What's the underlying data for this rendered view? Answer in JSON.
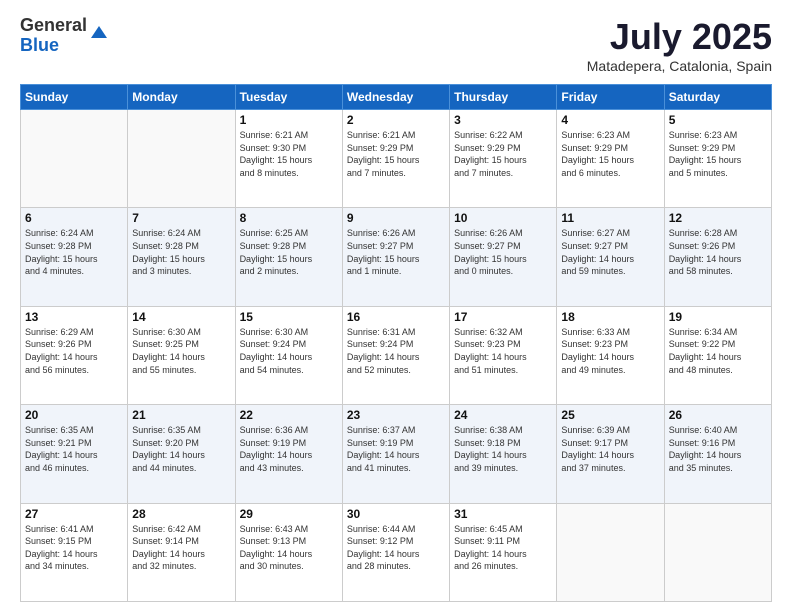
{
  "header": {
    "logo_general": "General",
    "logo_blue": "Blue",
    "month": "July 2025",
    "location": "Matadepera, Catalonia, Spain"
  },
  "days_of_week": [
    "Sunday",
    "Monday",
    "Tuesday",
    "Wednesday",
    "Thursday",
    "Friday",
    "Saturday"
  ],
  "weeks": [
    [
      {
        "day": "",
        "text": ""
      },
      {
        "day": "",
        "text": ""
      },
      {
        "day": "1",
        "text": "Sunrise: 6:21 AM\nSunset: 9:30 PM\nDaylight: 15 hours\nand 8 minutes."
      },
      {
        "day": "2",
        "text": "Sunrise: 6:21 AM\nSunset: 9:29 PM\nDaylight: 15 hours\nand 7 minutes."
      },
      {
        "day": "3",
        "text": "Sunrise: 6:22 AM\nSunset: 9:29 PM\nDaylight: 15 hours\nand 7 minutes."
      },
      {
        "day": "4",
        "text": "Sunrise: 6:23 AM\nSunset: 9:29 PM\nDaylight: 15 hours\nand 6 minutes."
      },
      {
        "day": "5",
        "text": "Sunrise: 6:23 AM\nSunset: 9:29 PM\nDaylight: 15 hours\nand 5 minutes."
      }
    ],
    [
      {
        "day": "6",
        "text": "Sunrise: 6:24 AM\nSunset: 9:28 PM\nDaylight: 15 hours\nand 4 minutes."
      },
      {
        "day": "7",
        "text": "Sunrise: 6:24 AM\nSunset: 9:28 PM\nDaylight: 15 hours\nand 3 minutes."
      },
      {
        "day": "8",
        "text": "Sunrise: 6:25 AM\nSunset: 9:28 PM\nDaylight: 15 hours\nand 2 minutes."
      },
      {
        "day": "9",
        "text": "Sunrise: 6:26 AM\nSunset: 9:27 PM\nDaylight: 15 hours\nand 1 minute."
      },
      {
        "day": "10",
        "text": "Sunrise: 6:26 AM\nSunset: 9:27 PM\nDaylight: 15 hours\nand 0 minutes."
      },
      {
        "day": "11",
        "text": "Sunrise: 6:27 AM\nSunset: 9:27 PM\nDaylight: 14 hours\nand 59 minutes."
      },
      {
        "day": "12",
        "text": "Sunrise: 6:28 AM\nSunset: 9:26 PM\nDaylight: 14 hours\nand 58 minutes."
      }
    ],
    [
      {
        "day": "13",
        "text": "Sunrise: 6:29 AM\nSunset: 9:26 PM\nDaylight: 14 hours\nand 56 minutes."
      },
      {
        "day": "14",
        "text": "Sunrise: 6:30 AM\nSunset: 9:25 PM\nDaylight: 14 hours\nand 55 minutes."
      },
      {
        "day": "15",
        "text": "Sunrise: 6:30 AM\nSunset: 9:24 PM\nDaylight: 14 hours\nand 54 minutes."
      },
      {
        "day": "16",
        "text": "Sunrise: 6:31 AM\nSunset: 9:24 PM\nDaylight: 14 hours\nand 52 minutes."
      },
      {
        "day": "17",
        "text": "Sunrise: 6:32 AM\nSunset: 9:23 PM\nDaylight: 14 hours\nand 51 minutes."
      },
      {
        "day": "18",
        "text": "Sunrise: 6:33 AM\nSunset: 9:23 PM\nDaylight: 14 hours\nand 49 minutes."
      },
      {
        "day": "19",
        "text": "Sunrise: 6:34 AM\nSunset: 9:22 PM\nDaylight: 14 hours\nand 48 minutes."
      }
    ],
    [
      {
        "day": "20",
        "text": "Sunrise: 6:35 AM\nSunset: 9:21 PM\nDaylight: 14 hours\nand 46 minutes."
      },
      {
        "day": "21",
        "text": "Sunrise: 6:35 AM\nSunset: 9:20 PM\nDaylight: 14 hours\nand 44 minutes."
      },
      {
        "day": "22",
        "text": "Sunrise: 6:36 AM\nSunset: 9:19 PM\nDaylight: 14 hours\nand 43 minutes."
      },
      {
        "day": "23",
        "text": "Sunrise: 6:37 AM\nSunset: 9:19 PM\nDaylight: 14 hours\nand 41 minutes."
      },
      {
        "day": "24",
        "text": "Sunrise: 6:38 AM\nSunset: 9:18 PM\nDaylight: 14 hours\nand 39 minutes."
      },
      {
        "day": "25",
        "text": "Sunrise: 6:39 AM\nSunset: 9:17 PM\nDaylight: 14 hours\nand 37 minutes."
      },
      {
        "day": "26",
        "text": "Sunrise: 6:40 AM\nSunset: 9:16 PM\nDaylight: 14 hours\nand 35 minutes."
      }
    ],
    [
      {
        "day": "27",
        "text": "Sunrise: 6:41 AM\nSunset: 9:15 PM\nDaylight: 14 hours\nand 34 minutes."
      },
      {
        "day": "28",
        "text": "Sunrise: 6:42 AM\nSunset: 9:14 PM\nDaylight: 14 hours\nand 32 minutes."
      },
      {
        "day": "29",
        "text": "Sunrise: 6:43 AM\nSunset: 9:13 PM\nDaylight: 14 hours\nand 30 minutes."
      },
      {
        "day": "30",
        "text": "Sunrise: 6:44 AM\nSunset: 9:12 PM\nDaylight: 14 hours\nand 28 minutes."
      },
      {
        "day": "31",
        "text": "Sunrise: 6:45 AM\nSunset: 9:11 PM\nDaylight: 14 hours\nand 26 minutes."
      },
      {
        "day": "",
        "text": ""
      },
      {
        "day": "",
        "text": ""
      }
    ]
  ]
}
